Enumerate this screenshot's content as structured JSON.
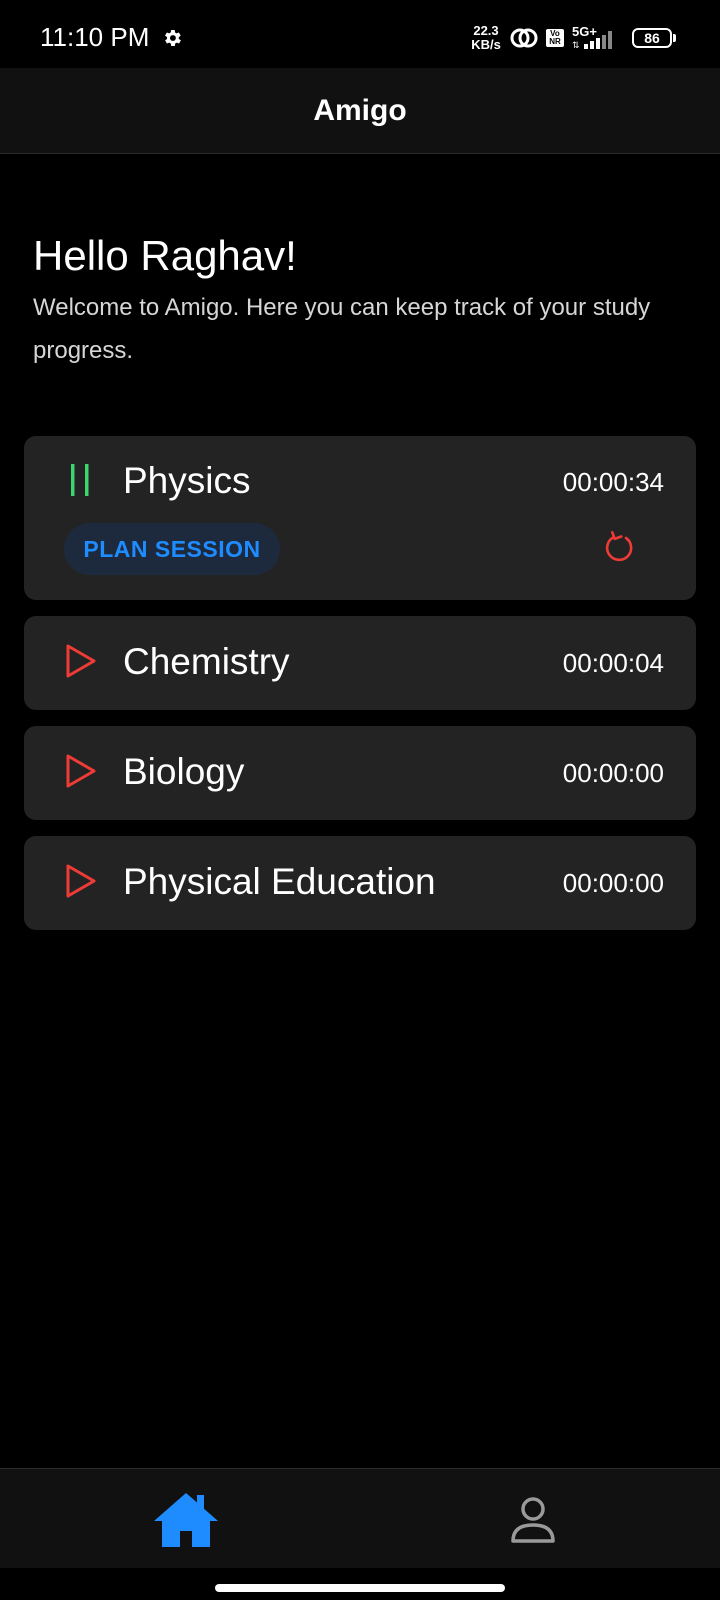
{
  "status_bar": {
    "time": "11:10 PM",
    "net_speed_value": "22.3",
    "net_speed_unit": "KB/s",
    "volte": "Vo NR",
    "network": "5G+",
    "battery": "86",
    "icons": [
      "gear-icon",
      "hotspot-icon",
      "volte-icon",
      "signal-icon",
      "battery-icon"
    ]
  },
  "app_bar": {
    "title": "Amigo"
  },
  "greeting": {
    "title": "Hello Raghav!",
    "subtitle": "Welcome to Amigo. Here you can keep track of your study progress."
  },
  "subjects": [
    {
      "name": "Physics",
      "time": "00:00:34",
      "state": "running",
      "icon": "pause-icon",
      "action_label": "PLAN SESSION",
      "reset_icon": "reset-icon"
    },
    {
      "name": "Chemistry",
      "time": "00:00:04",
      "state": "stopped",
      "icon": "play-icon"
    },
    {
      "name": "Biology",
      "time": "00:00:00",
      "state": "stopped",
      "icon": "play-icon"
    },
    {
      "name": "Physical Education",
      "time": "00:00:00",
      "state": "stopped",
      "icon": "play-icon"
    }
  ],
  "bottom_nav": {
    "items": [
      {
        "icon": "home-icon",
        "active": true
      },
      {
        "icon": "profile-icon",
        "active": false
      }
    ]
  },
  "colors": {
    "background": "#000000",
    "card": "#232323",
    "accent_blue": "#1e8cff",
    "play_red": "#ef3b36",
    "pause_green": "#3dd56d",
    "inactive_icon": "#9a9a9a"
  }
}
